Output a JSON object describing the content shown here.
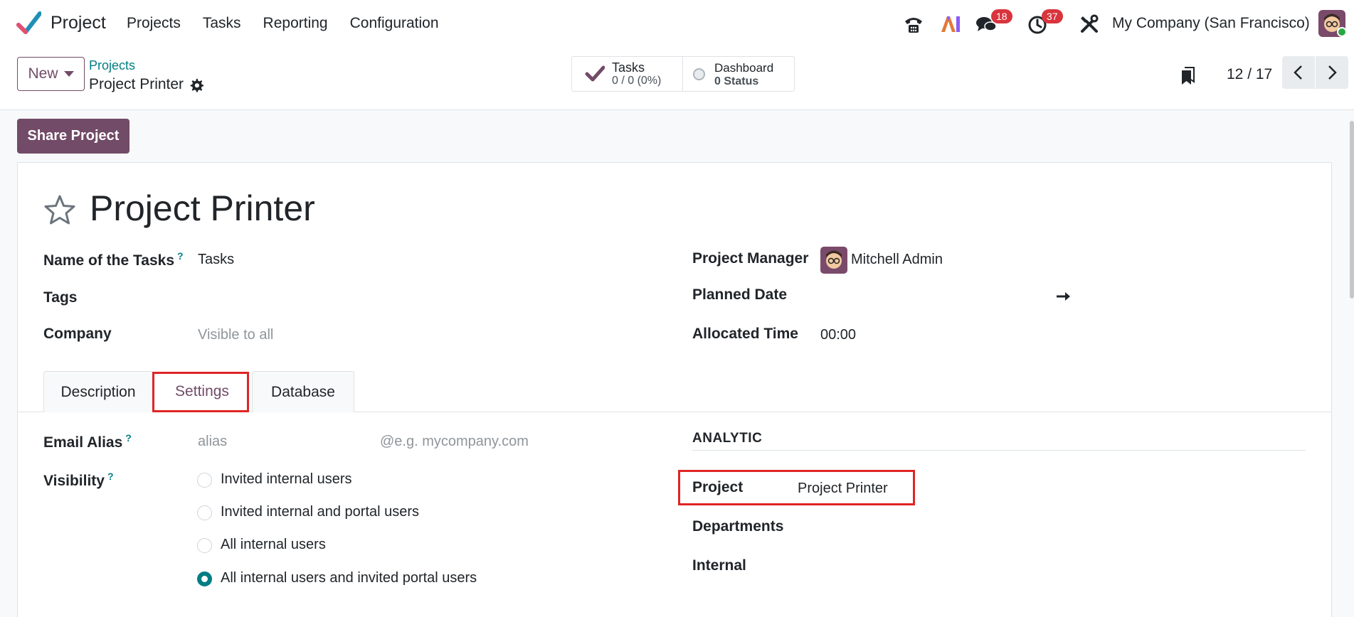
{
  "navbar": {
    "app_name": "Project",
    "menu": [
      "Projects",
      "Tasks",
      "Reporting",
      "Configuration"
    ],
    "messages_count": "18",
    "activities_count": "37",
    "company": "My Company (San Francisco)",
    "icons": [
      "phone-icon",
      "ai-icon",
      "chat-icon",
      "clock-icon",
      "tools-icon"
    ]
  },
  "control": {
    "new_label": "New",
    "breadcrumb_parent": "Projects",
    "breadcrumb_current": "Project Printer",
    "stats": {
      "tasks_label": "Tasks",
      "tasks_value": "0 / 0 (0%)",
      "dashboard_label": "Dashboard",
      "dashboard_value": "0 Status"
    },
    "pager": "12 / 17"
  },
  "share_label": "Share Project",
  "form": {
    "title": "Project Printer",
    "name_of_tasks_label": "Name of the Tasks",
    "name_of_tasks_value": "Tasks",
    "tags_label": "Tags",
    "company_label": "Company",
    "company_placeholder": "Visible to all",
    "project_manager_label": "Project Manager",
    "project_manager_value": "Mitchell Admin",
    "planned_date_label": "Planned Date",
    "allocated_time_label": "Allocated Time",
    "allocated_time_value": "00:00",
    "help_mark": "?"
  },
  "tabs": [
    "Description",
    "Settings",
    "Database"
  ],
  "settings": {
    "email_alias_label": "Email Alias",
    "alias_placeholder": "alias",
    "domain_placeholder": "@e.g. mycompany.com",
    "visibility_label": "Visibility",
    "visibility_options": [
      "Invited internal users",
      "Invited internal and portal users",
      "All internal users",
      "All internal users and invited portal users"
    ],
    "visibility_selected": 3,
    "analytic_heading": "ANALYTIC",
    "project_label": "Project",
    "project_value": "Project Printer",
    "departments_label": "Departments",
    "internal_label": "Internal"
  },
  "colors": {
    "brand": "#714b67",
    "link": "#017e84",
    "badge": "#d9343d",
    "highlight": "#e02424"
  }
}
